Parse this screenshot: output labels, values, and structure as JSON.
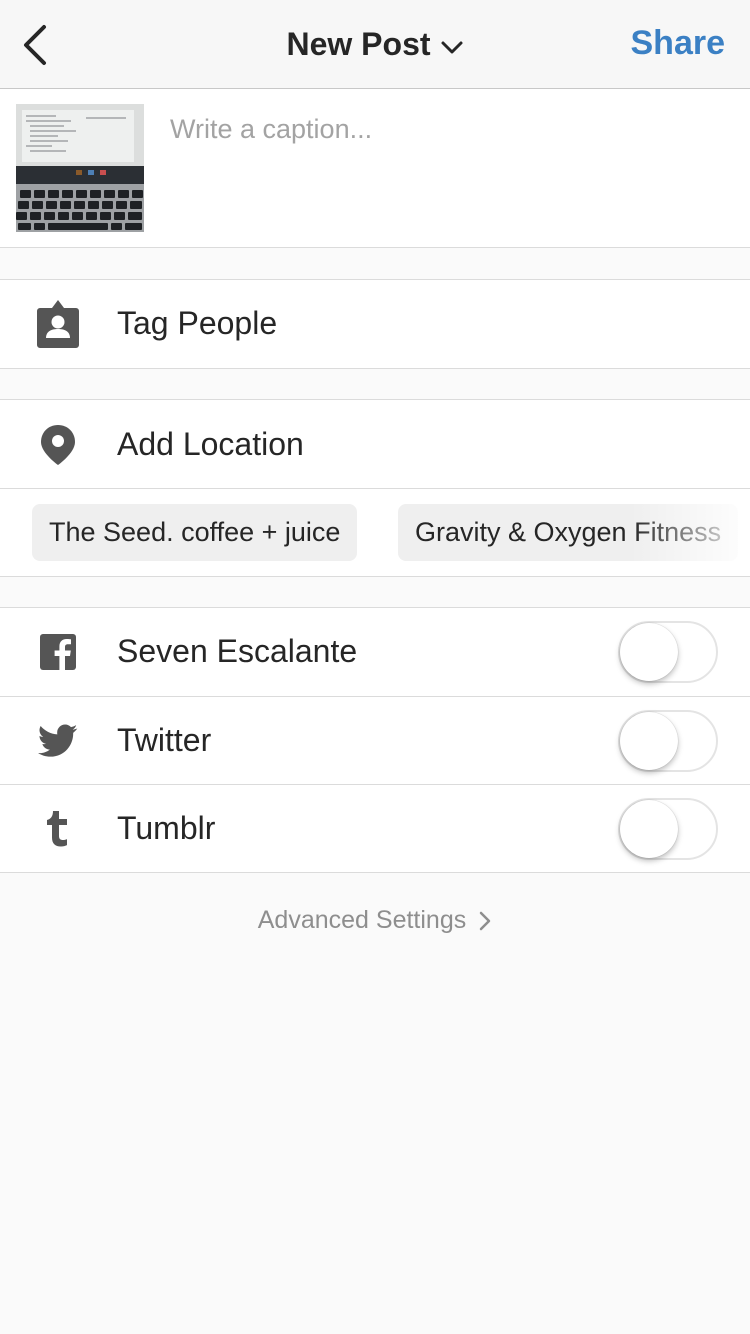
{
  "header": {
    "title": "New Post",
    "share_label": "Share",
    "accent_color": "#3b80c4"
  },
  "caption": {
    "placeholder": "Write a caption...",
    "value": ""
  },
  "rows": {
    "tag_people": {
      "label": "Tag People",
      "icon": "tag-person-icon"
    },
    "add_location": {
      "label": "Add Location",
      "icon": "location-pin-icon"
    }
  },
  "location_suggestions": [
    {
      "label": "The Seed. coffee + juice"
    },
    {
      "label": "Gravity & Oxygen Fitness"
    }
  ],
  "share_to": [
    {
      "label": "Seven Escalante",
      "icon": "facebook-icon",
      "enabled": false
    },
    {
      "label": "Twitter",
      "icon": "twitter-icon",
      "enabled": false
    },
    {
      "label": "Tumblr",
      "icon": "tumblr-icon",
      "enabled": false
    }
  ],
  "footer": {
    "advanced_label": "Advanced Settings"
  }
}
